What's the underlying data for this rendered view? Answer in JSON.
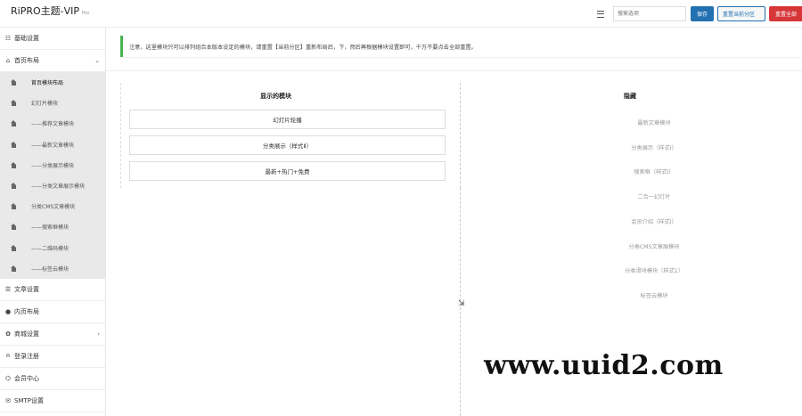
{
  "header": {
    "brand": "RiPRO主题-VIP",
    "brand_badge": "Pro",
    "search_placeholder": "搜索选项",
    "save_label": "保存",
    "reset_section_label": "重置当前分区",
    "reset_all_label": "重置全部"
  },
  "sidebar": {
    "items": [
      {
        "label": "基础设置",
        "icon": "gear-icon"
      },
      {
        "label": "首页布局",
        "icon": "home-icon",
        "expanded": true
      },
      {
        "label": "文章设置",
        "icon": "list-icon"
      },
      {
        "label": "内页布局",
        "icon": "circle-icon"
      },
      {
        "label": "商城设置",
        "icon": "cog-icon",
        "has_children": true
      },
      {
        "label": "登录注册",
        "icon": "user-icon"
      },
      {
        "label": "会员中心",
        "icon": "lock-icon"
      },
      {
        "label": "SMTP设置",
        "icon": "mail-icon"
      }
    ],
    "sub_items": [
      {
        "label": "首页模块布局",
        "active": true
      },
      {
        "label": "幻灯片模块"
      },
      {
        "label": "——推荐文章模块"
      },
      {
        "label": "——最新文章模块"
      },
      {
        "label": "——分类展示模块"
      },
      {
        "label": "——分类文章展示模块"
      },
      {
        "label": "分类CMS文章模块"
      },
      {
        "label": "——搜索框模块"
      },
      {
        "label": "——二维码模块"
      },
      {
        "label": "——标签云模块"
      }
    ]
  },
  "notice": "注意，这里模块只可以排列组合本版本设定的模块，请重置【当前分区】重新布局后，下，然后再根据模块设置即可，千万不要点击全部重置。",
  "sorter": {
    "enabled_title": "显示的模块",
    "enabled": [
      "幻灯片轮播",
      "分类展示（样式Ⅱ）",
      "最新+热门+免费"
    ],
    "disabled_title": "隐藏",
    "disabled": [
      "最新文章模块",
      "分类展示（样式Ⅰ）",
      "搜索框（样式Ⅰ）",
      "二合一幻灯片",
      "会员介绍（样式Ⅰ）",
      "分类CMS文章展模块",
      "分类滑块模块（样式1）",
      "标签云模块"
    ]
  },
  "watermark": "www.uuid2.com"
}
